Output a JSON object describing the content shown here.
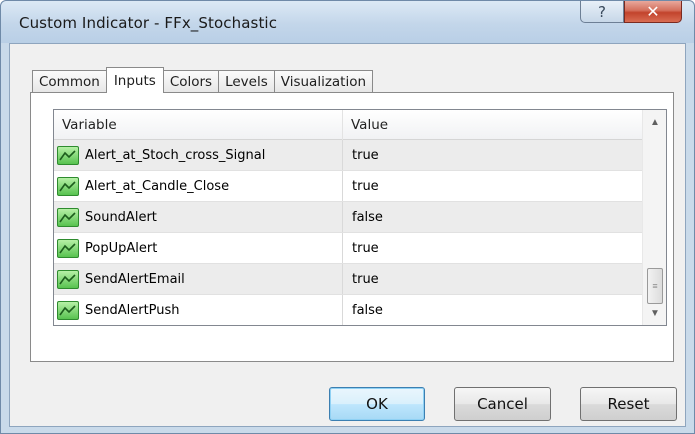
{
  "window": {
    "title": "Custom Indicator - FFx_Stochastic",
    "help_glyph": "?",
    "close_glyph": "✕"
  },
  "tabs": [
    {
      "label": "Common",
      "active": false
    },
    {
      "label": "Inputs",
      "active": true
    },
    {
      "label": "Colors",
      "active": false
    },
    {
      "label": "Levels",
      "active": false
    },
    {
      "label": "Visualization",
      "active": false
    }
  ],
  "grid": {
    "columns": {
      "variable": "Variable",
      "value": "Value"
    },
    "rows": [
      {
        "variable": "Alert_at_Stoch_cross_Signal",
        "value": "true",
        "icon": "indicator-param-icon"
      },
      {
        "variable": "Alert_at_Candle_Close",
        "value": "true",
        "icon": "indicator-param-icon"
      },
      {
        "variable": "SoundAlert",
        "value": "false",
        "icon": "indicator-param-icon"
      },
      {
        "variable": "PopUpAlert",
        "value": "true",
        "icon": "indicator-param-icon"
      },
      {
        "variable": "SendAlertEmail",
        "value": "true",
        "icon": "indicator-param-icon"
      },
      {
        "variable": "SendAlertPush",
        "value": "false",
        "icon": "indicator-param-icon"
      }
    ]
  },
  "buttons": {
    "ok": "OK",
    "cancel": "Cancel",
    "reset": "Reset"
  },
  "colors": {
    "titlebar": "#c3d6ea",
    "close_button": "#c2432c",
    "icon_green": "#58c250",
    "alt_row": "#ececec"
  }
}
